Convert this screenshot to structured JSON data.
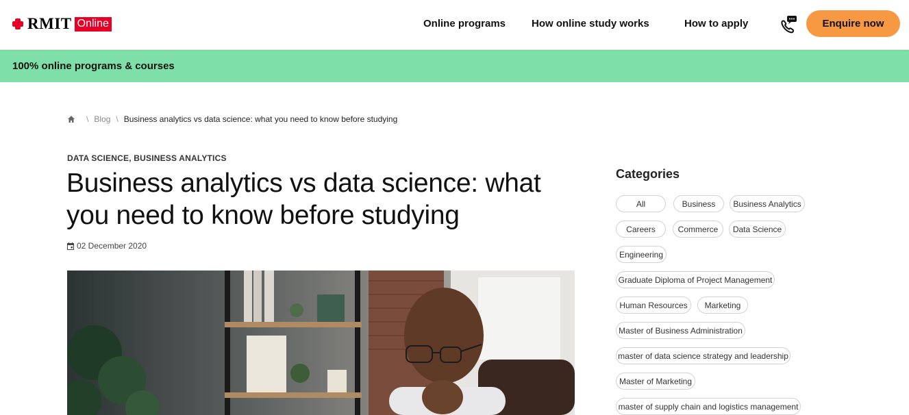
{
  "brand": {
    "name": "RMIT",
    "suffix": "Online",
    "color": "#e60028"
  },
  "nav": {
    "items": [
      "Online programs",
      "How online study works",
      "How to apply"
    ],
    "contact_icon": "phone-chat-icon",
    "cta_label": "Enquire now",
    "cta_color": "#f79943"
  },
  "banner": {
    "text": "100% online programs & courses",
    "color": "#7ee0a8"
  },
  "breadcrumb": {
    "home_icon": "home-icon",
    "items": [
      "Blog",
      "Business analytics vs data science: what you need to know before studying"
    ]
  },
  "article": {
    "tags": [
      "DATA SCIENCE",
      "BUSINESS ANALYTICS"
    ],
    "title": "Business analytics vs data science: what you need to know before studying",
    "date": "02 December 2020",
    "date_icon": "calendar-icon",
    "image": "man-with-glasses-thinking-photo"
  },
  "sidebar": {
    "categories_title": "Categories",
    "categories": [
      "All",
      "Business",
      "Business Analytics",
      "Careers",
      "Commerce",
      "Data Science",
      "Engineering",
      "Graduate Diploma of Project Management",
      "Human Resources",
      "Marketing",
      "Master of Business Administration",
      "master of data science strategy and leadership",
      "Master of Marketing",
      "master of supply chain and logistics management"
    ]
  }
}
